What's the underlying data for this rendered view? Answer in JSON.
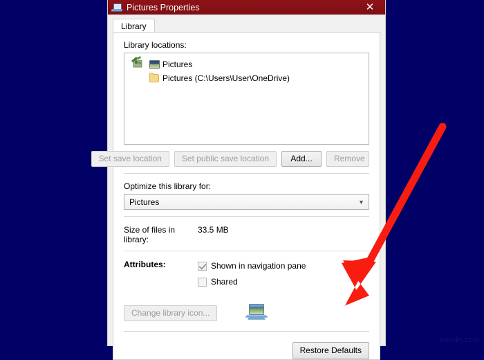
{
  "desktop": {
    "background_color": "#000066",
    "watermark": "wsxdn.com"
  },
  "dialog": {
    "title": "Pictures Properties",
    "title_icon": "library-computer-icon",
    "titlebar_color": "#8b1117",
    "close_icon": "close-icon",
    "close_label": "✕",
    "tabs": [
      {
        "label": "Library",
        "selected": true
      }
    ],
    "library_locations": {
      "label": "Library locations:",
      "group_icon": "library-people-icon",
      "items": [
        {
          "icon": "picture-frame-icon",
          "label": "Pictures"
        },
        {
          "icon": "folder-icon",
          "label": "Pictures (C:\\Users\\User\\OneDrive)"
        }
      ]
    },
    "location_buttons": [
      {
        "label": "Set save location",
        "enabled": false
      },
      {
        "label": "Set public save location",
        "enabled": false
      },
      {
        "label": "Add...",
        "enabled": true
      },
      {
        "label": "Remove",
        "enabled": false
      }
    ],
    "optimize": {
      "label": "Optimize this library for:",
      "selected": "Pictures",
      "dropdown_icon": "chevron-down-icon"
    },
    "size": {
      "label": "Size of files in library:",
      "value": "33.5 MB"
    },
    "attributes": {
      "label": "Attributes:",
      "checkboxes": [
        {
          "label": "Shown in navigation pane",
          "checked": true,
          "enabled": false
        },
        {
          "label": "Shared",
          "checked": false,
          "enabled": true
        }
      ]
    },
    "change_icon": {
      "button_label": "Change library icon...",
      "enabled": false,
      "preview_icon": "pictures-library-icon"
    },
    "footer": {
      "restore_label": "Restore Defaults",
      "enabled": true
    }
  },
  "annotation": {
    "type": "arrow",
    "color": "#f81d10",
    "points_to": "Restore Defaults"
  }
}
